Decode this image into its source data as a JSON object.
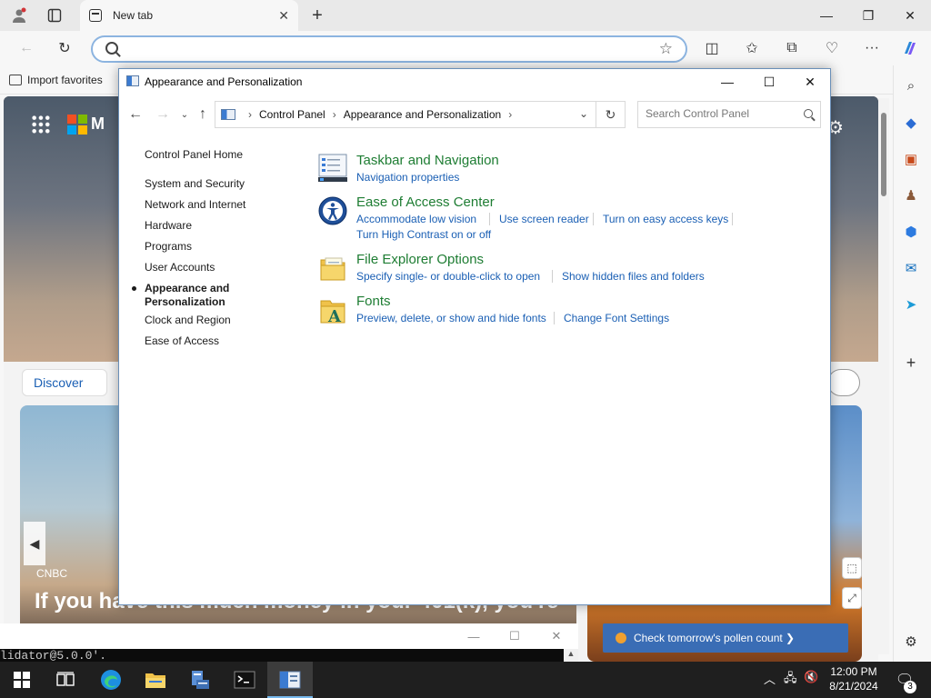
{
  "browser": {
    "tab_title": "New tab",
    "favorites_import": "Import favorites",
    "address_placeholder": ""
  },
  "ntp": {
    "logo_text": "M",
    "discover_label": "Discover",
    "news_source": "CNBC",
    "news_headline": "If you have this much money in your 401(k), you're",
    "pollen_label": "Check tomorrow's pollen count ❯"
  },
  "terminal": {
    "text": "lidator@5.0.0'."
  },
  "control_panel": {
    "window_title": "Appearance and Personalization",
    "breadcrumbs": [
      "Control Panel",
      "Appearance and Personalization"
    ],
    "search_placeholder": "Search Control Panel",
    "left_nav": {
      "home": "Control Panel Home",
      "items": [
        "System and Security",
        "Network and Internet",
        "Hardware",
        "Programs",
        "User Accounts"
      ],
      "current_line1": "Appearance and",
      "current_line2": "Personalization",
      "items_after": [
        "Clock and Region",
        "Ease of Access"
      ]
    },
    "categories": [
      {
        "title": "Taskbar and Navigation",
        "links": [
          "Navigation properties"
        ]
      },
      {
        "title": "Ease of Access Center",
        "links": [
          "Accommodate low vision",
          "Use screen reader",
          "Turn on easy access keys",
          "Turn High Contrast on or off"
        ]
      },
      {
        "title": "File Explorer Options",
        "links": [
          "Specify single- or double-click to open",
          "Show hidden files and folders"
        ]
      },
      {
        "title": "Fonts",
        "links": [
          "Preview, delete, or show and hide fonts",
          "Change Font Settings"
        ]
      }
    ]
  },
  "taskbar": {
    "time": "12:00 PM",
    "date": "8/21/2024",
    "notification_count": "3"
  },
  "colors": {
    "category_title": "#1e7d33",
    "link": "#1a5fb4",
    "taskbar": "#1f1f1f"
  }
}
